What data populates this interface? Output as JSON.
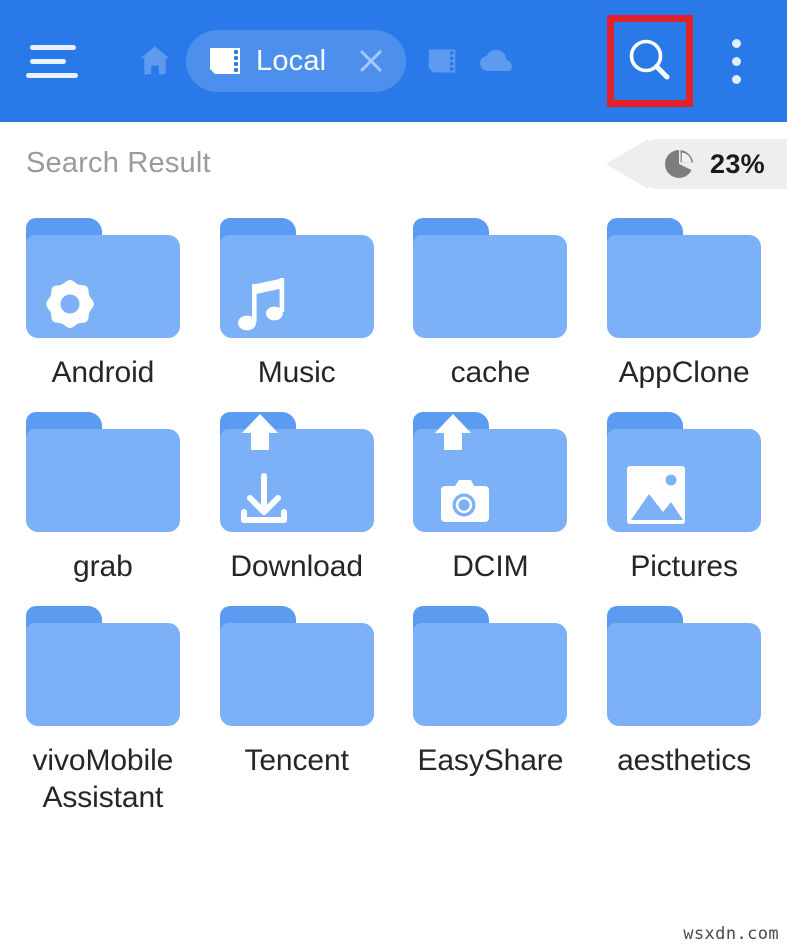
{
  "appbar": {
    "menu_icon": "hamburger-menu-icon",
    "home_icon": "home-icon",
    "path_chip": {
      "icon": "sd-card-icon",
      "label": "Local",
      "close_icon": "close-x-icon"
    },
    "sdcard_icon": "sd-card-icon",
    "cloud_icon": "cloud-icon",
    "search_icon": "search-icon",
    "overflow_icon": "more-vertical-icon",
    "background_color": "#2979e8",
    "highlight_color": "#e02128"
  },
  "subheader": {
    "title": "Search Result",
    "storage_badge": {
      "icon": "pie-chart-icon",
      "value": "23%"
    }
  },
  "grid": {
    "items": [
      {
        "label": "Android",
        "glyph": "gear-icon",
        "up_badge": false
      },
      {
        "label": "Music",
        "glyph": "music-note-icon",
        "up_badge": false
      },
      {
        "label": "cache",
        "glyph": "none",
        "up_badge": false
      },
      {
        "label": "AppClone",
        "glyph": "none",
        "up_badge": false
      },
      {
        "label": "grab",
        "glyph": "none",
        "up_badge": false
      },
      {
        "label": "Download",
        "glyph": "download-arrow-icon",
        "up_badge": true
      },
      {
        "label": "DCIM",
        "glyph": "camera-icon",
        "up_badge": true
      },
      {
        "label": "Pictures",
        "glyph": "image-icon",
        "up_badge": false
      },
      {
        "label": "vivoMobile Assistant",
        "glyph": "none",
        "up_badge": false
      },
      {
        "label": "Tencent",
        "glyph": "none",
        "up_badge": false
      },
      {
        "label": "EasyShare",
        "glyph": "none",
        "up_badge": false
      },
      {
        "label": "aesthetics",
        "glyph": "none",
        "up_badge": false
      }
    ],
    "folder_color": "#7cb1f7",
    "folder_tab_color": "#5b9cf2"
  },
  "watermark": {
    "text": "wsxdn.com"
  }
}
